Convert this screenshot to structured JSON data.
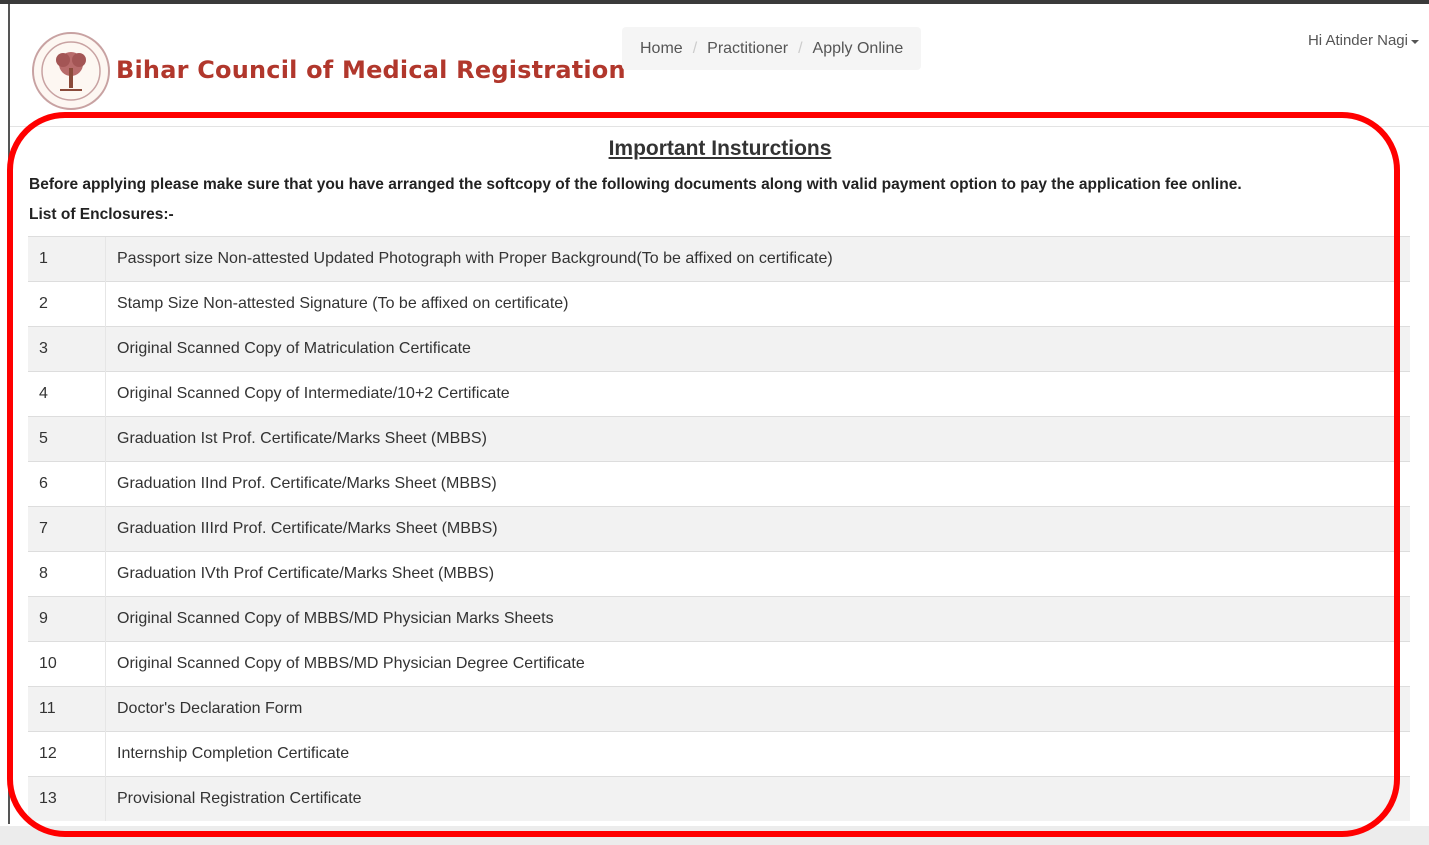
{
  "header": {
    "brand": "Bihar Council of Medical Registration",
    "logo_icon": "council-seal-icon",
    "breadcrumb": [
      {
        "label": "Home"
      },
      {
        "label": "Practitioner"
      },
      {
        "label": "Apply Online"
      }
    ],
    "user_greeting": "Hi Atinder Nagi"
  },
  "main": {
    "title": "Important Insturctions",
    "lead": "Before applying please make sure that you have arranged the softcopy of the following documents along with valid payment option to pay the application fee online.",
    "enclosures_label": "List of Enclosures:-",
    "enclosures": [
      {
        "num": "1",
        "text": "Passport size Non-attested Updated Photograph with Proper Background(To be affixed on certificate)"
      },
      {
        "num": "2",
        "text": "Stamp Size Non-attested Signature (To be affixed on certificate)"
      },
      {
        "num": "3",
        "text": "Original Scanned Copy of Matriculation Certificate"
      },
      {
        "num": "4",
        "text": "Original Scanned Copy of Intermediate/10+2 Certificate"
      },
      {
        "num": "5",
        "text": "Graduation Ist Prof. Certificate/Marks Sheet (MBBS)"
      },
      {
        "num": "6",
        "text": "Graduation IInd Prof. Certificate/Marks Sheet (MBBS)"
      },
      {
        "num": "7",
        "text": "Graduation IIIrd Prof. Certificate/Marks Sheet (MBBS)"
      },
      {
        "num": "8",
        "text": "Graduation IVth Prof Certificate/Marks Sheet (MBBS)"
      },
      {
        "num": "9",
        "text": "Original Scanned Copy of MBBS/MD Physician Marks Sheets"
      },
      {
        "num": "10",
        "text": "Original Scanned Copy of MBBS/MD Physician Degree Certificate"
      },
      {
        "num": "11",
        "text": "Doctor's Declaration Form"
      },
      {
        "num": "12",
        "text": "Internship Completion Certificate"
      },
      {
        "num": "13",
        "text": "Provisional Registration Certificate"
      }
    ]
  },
  "colors": {
    "brand": "#b1372c",
    "highlight": "#ff0000"
  }
}
